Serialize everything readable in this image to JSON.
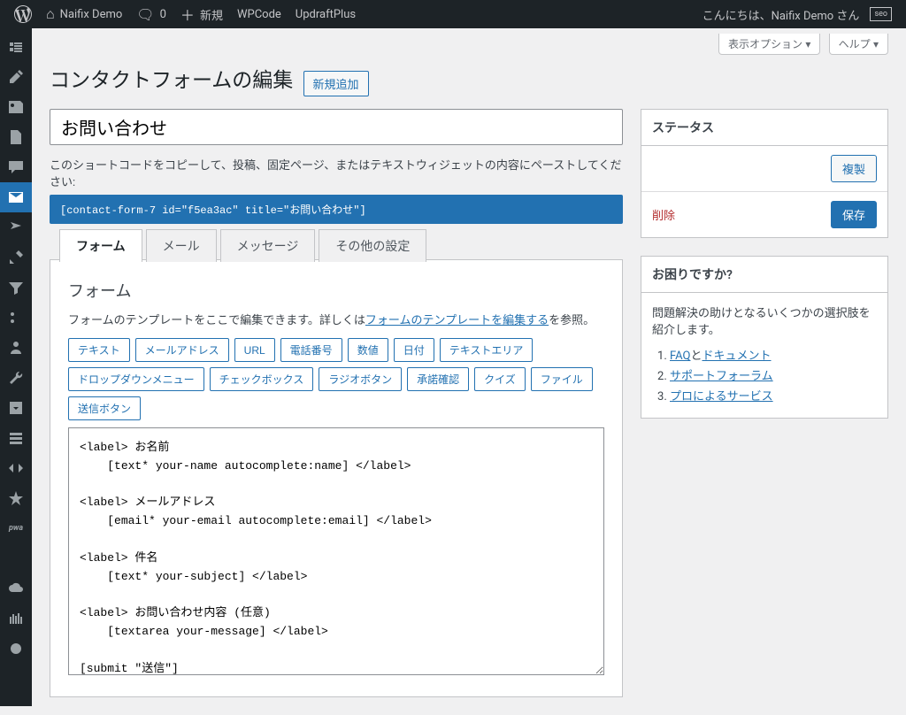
{
  "adminbar": {
    "site_name": "Naifix Demo",
    "comments": "0",
    "new": "新規",
    "items": [
      "WPCode",
      "UpdraftPlus"
    ],
    "greeting": "こんにちは、Naifix Demo さん",
    "seo_badge": "seo"
  },
  "screen_meta": {
    "options": "表示オプション ▾",
    "help": "ヘルプ ▾"
  },
  "page": {
    "title": "コンタクトフォームの編集",
    "add_new": "新規追加"
  },
  "form": {
    "title_value": "お問い合わせ",
    "shortcode_hint": "このショートコードをコピーして、投稿、固定ページ、またはテキストウィジェットの内容にペーストしてください:",
    "shortcode": "[contact-form-7 id=\"f5ea3ac\" title=\"お問い合わせ\"]"
  },
  "status_box": {
    "title": "ステータス",
    "duplicate": "複製",
    "delete": "削除",
    "save": "保存"
  },
  "help_box": {
    "title": "お困りですか?",
    "intro": "問題解決の助けとなるいくつかの選択肢を紹介します。",
    "faq_pre": "FAQ",
    "faq_joiner": "と",
    "faq_post": "ドキュメント",
    "support": "サポートフォーラム",
    "pro": "プロによるサービス"
  },
  "tabs": {
    "form": "フォーム",
    "mail": "メール",
    "messages": "メッセージ",
    "other": "その他の設定"
  },
  "editor": {
    "section_title": "フォーム",
    "desc_pre": "フォームのテンプレートをここで編集できます。詳しくは",
    "desc_link": "フォームのテンプレートを編集する",
    "desc_post": "を参照。",
    "tags": [
      "テキスト",
      "メールアドレス",
      "URL",
      "電話番号",
      "数値",
      "日付",
      "テキストエリア",
      "ドロップダウンメニュー",
      "チェックボックス",
      "ラジオボタン",
      "承諾確認",
      "クイズ",
      "ファイル",
      "送信ボタン"
    ],
    "template": "<label> お名前\n    [text* your-name autocomplete:name] </label>\n\n<label> メールアドレス\n    [email* your-email autocomplete:email] </label>\n\n<label> 件名\n    [text* your-subject] </label>\n\n<label> お問い合わせ内容 (任意)\n    [textarea your-message] </label>\n\n[submit \"送信\"]"
  }
}
